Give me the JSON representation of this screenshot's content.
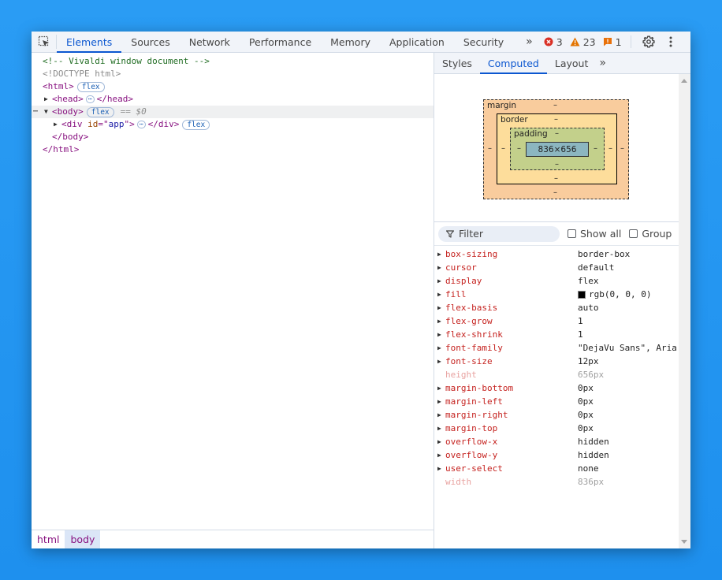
{
  "toolbar": {
    "tabs": [
      {
        "label": "Elements",
        "active": true
      },
      {
        "label": "Sources",
        "active": false
      },
      {
        "label": "Network",
        "active": false
      },
      {
        "label": "Performance",
        "active": false
      },
      {
        "label": "Memory",
        "active": false
      },
      {
        "label": "Application",
        "active": false
      },
      {
        "label": "Security",
        "active": false
      }
    ],
    "more_tabs": "»",
    "errors": "3",
    "warnings": "23",
    "issues": "1",
    "icons": [
      "inspect-element-icon",
      "error-icon",
      "warning-icon",
      "issue-icon",
      "gear-icon",
      "kebab-menu-icon"
    ]
  },
  "dom": {
    "comment": "<!-- Vivaldi window document -->",
    "doctype": "<!DOCTYPE html>",
    "html_open": "<html>",
    "head_open": "<head>",
    "head_close": "</head>",
    "body_open": "<body>",
    "body_close": "</body>",
    "div_open_start": "<div ",
    "div_attr_name": "id",
    "div_attr_eq": "=\"",
    "div_attr_val": "app",
    "div_attr_end": "\">",
    "div_close": "</div>",
    "html_close": "</html>",
    "flex_badge": "flex",
    "ellipsis": "⋯",
    "selected_marker": "== $0",
    "row_dots": "⋯"
  },
  "breadcrumbs": [
    {
      "label": "html",
      "active": false
    },
    {
      "label": "body",
      "active": true
    }
  ],
  "sidepanel": {
    "tabs": [
      {
        "label": "Styles",
        "active": false
      },
      {
        "label": "Computed",
        "active": true
      },
      {
        "label": "Layout",
        "active": false
      }
    ],
    "more_tabs": "»",
    "box_model": {
      "margin_label": "margin",
      "border_label": "border",
      "padding_label": "padding",
      "content": "836×656",
      "dash": "–"
    },
    "filter": {
      "placeholder": "Filter",
      "show_all_label": "Show all",
      "show_all_checked": false,
      "group_label": "Group",
      "group_checked": false
    },
    "properties": [
      {
        "name": "box-sizing",
        "value": "border-box",
        "expandable": true
      },
      {
        "name": "cursor",
        "value": "default",
        "expandable": true
      },
      {
        "name": "display",
        "value": "flex",
        "expandable": true
      },
      {
        "name": "fill",
        "value": "rgb(0, 0, 0)",
        "expandable": true,
        "swatch": "#000000"
      },
      {
        "name": "flex-basis",
        "value": "auto",
        "expandable": true
      },
      {
        "name": "flex-grow",
        "value": "1",
        "expandable": true
      },
      {
        "name": "flex-shrink",
        "value": "1",
        "expandable": true
      },
      {
        "name": "font-family",
        "value": "\"DejaVu Sans\", Aria",
        "expandable": true
      },
      {
        "name": "font-size",
        "value": "12px",
        "expandable": true
      },
      {
        "name": "height",
        "value": "656px",
        "expandable": false
      },
      {
        "name": "margin-bottom",
        "value": "0px",
        "expandable": true
      },
      {
        "name": "margin-left",
        "value": "0px",
        "expandable": true
      },
      {
        "name": "margin-right",
        "value": "0px",
        "expandable": true
      },
      {
        "name": "margin-top",
        "value": "0px",
        "expandable": true
      },
      {
        "name": "overflow-x",
        "value": "hidden",
        "expandable": true
      },
      {
        "name": "overflow-y",
        "value": "hidden",
        "expandable": true
      },
      {
        "name": "user-select",
        "value": "none",
        "expandable": true
      },
      {
        "name": "width",
        "value": "836px",
        "expandable": false
      }
    ]
  },
  "colors": {
    "accent": "#0b57d0",
    "background": "#2196f3",
    "error": "#d93025",
    "warning": "#e37400",
    "issue": "#e8710a"
  }
}
